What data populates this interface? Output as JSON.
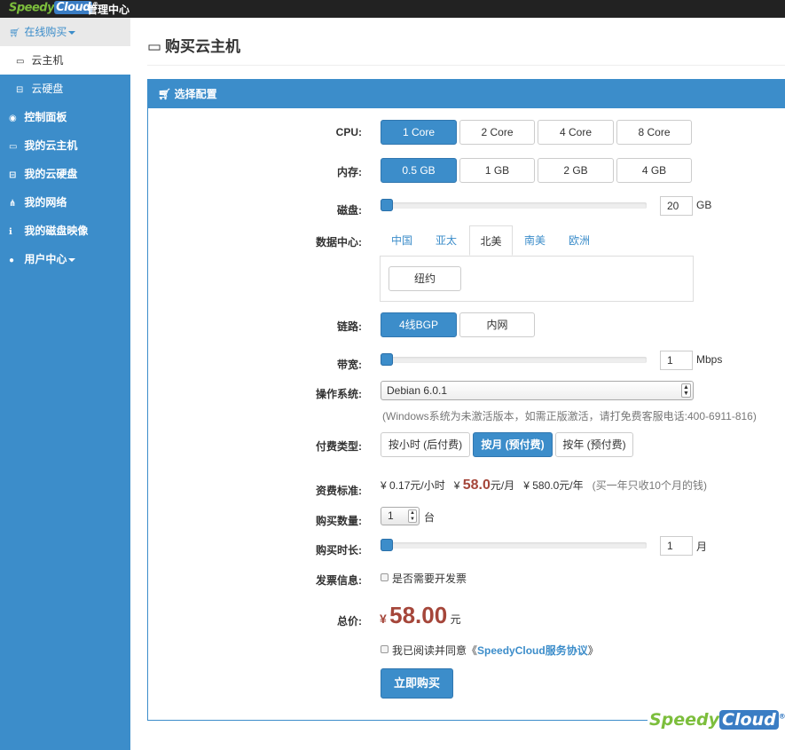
{
  "topbar": {
    "logo_text_a": "Speedy",
    "logo_text_b": "Cloud",
    "logo_mark": "®",
    "title": "管理中心"
  },
  "sidebar": {
    "items": [
      {
        "label": "在线购买",
        "icon": "cart-icon"
      },
      {
        "label": "云主机",
        "icon": "monitor-icon"
      },
      {
        "label": "云硬盘",
        "icon": "disk-icon"
      },
      {
        "label": "控制面板",
        "icon": "dashboard-icon"
      },
      {
        "label": "我的云主机",
        "icon": "monitor-icon"
      },
      {
        "label": "我的云硬盘",
        "icon": "disk-icon"
      },
      {
        "label": "我的网络",
        "icon": "sitemap-icon"
      },
      {
        "label": "我的磁盘映像",
        "icon": "info-icon"
      },
      {
        "label": "用户中心",
        "icon": "user-icon"
      }
    ]
  },
  "page": {
    "title": "购买云主机",
    "panel_title": "选择配置"
  },
  "form": {
    "cpu": {
      "label": "CPU:",
      "options": [
        "1 Core",
        "2 Core",
        "4 Core",
        "8 Core"
      ],
      "selected": "1 Core"
    },
    "memory": {
      "label": "内存:",
      "options": [
        "0.5 GB",
        "1 GB",
        "2 GB",
        "4 GB"
      ],
      "selected": "0.5 GB"
    },
    "disk": {
      "label": "磁盘:",
      "value": "20",
      "unit": "GB",
      "level": 0.0
    },
    "datacenter": {
      "label": "数据中心:",
      "tabs": [
        "中国",
        "亚太",
        "北美",
        "南美",
        "欧洲"
      ],
      "active_tab": "北美",
      "cities": [
        "纽约"
      ]
    },
    "link": {
      "label": "链路:",
      "options": [
        "4线BGP",
        "内网"
      ],
      "selected": "4线BGP"
    },
    "bandwidth": {
      "label": "带宽:",
      "value": "1",
      "unit": "Mbps",
      "level": 0.0
    },
    "os": {
      "label": "操作系统:",
      "selected": "Debian 6.0.1",
      "hint": "(Windows系统为未激活版本，如需正版激活，请打免费客服电话:400-6911-816)"
    },
    "billing": {
      "label": "付费类型:",
      "options": [
        "按小时 (后付费)",
        "按月 (预付费)",
        "按年 (预付费)"
      ],
      "selected": "按月 (预付费)"
    },
    "pricing": {
      "label": "资费标准:",
      "hourly": "¥ 0.17元/小时",
      "monthly_prefix": "¥",
      "monthly_value": "58.0",
      "monthly_suffix": "元/月",
      "yearly": "¥ 580.0元/年",
      "note": "(买一年只收10个月的钱)"
    },
    "quantity": {
      "label": "购买数量:",
      "value": "1",
      "unit": "台"
    },
    "duration": {
      "label": "购买时长:",
      "value": "1",
      "unit": "月",
      "level": 0.0
    },
    "invoice": {
      "label": "发票信息:",
      "checkbox_label": "是否需要开发票"
    },
    "total": {
      "label": "总价:",
      "currency": "¥",
      "amount": "58.00",
      "unit": "元"
    },
    "agreement": {
      "prefix": "我已阅读并同意《",
      "link": "SpeedyCloud服务协议",
      "suffix": "》"
    },
    "submit_label": "立即购买"
  },
  "watermark": {
    "text_a": "Speedy",
    "text_b": "Cloud",
    "mark": "®"
  },
  "colors": {
    "accent": "#3c8dca",
    "price": "#a5463a",
    "brand_green": "#7cbe3c"
  }
}
